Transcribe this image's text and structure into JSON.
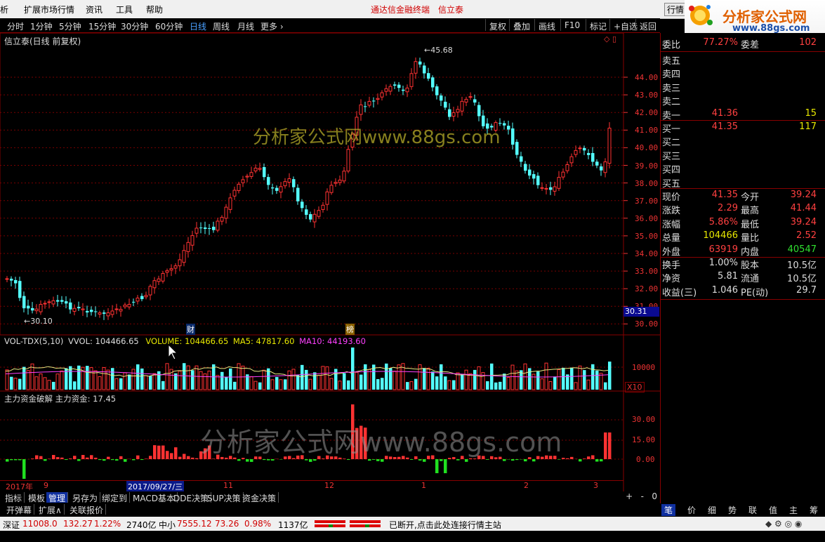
{
  "menu": {
    "items": [
      "析",
      "扩展市场行情",
      "资讯",
      "工具",
      "帮助"
    ],
    "title_left": "通达信金融终端",
    "title_right": "信立泰",
    "right_btn": "行情"
  },
  "logo": {
    "text": "分析家公式网",
    "url": "www.88gs.com"
  },
  "timeframes": [
    "分时",
    "1分钟",
    "5分钟",
    "15分钟",
    "30分钟",
    "60分钟",
    "日线",
    "周线",
    "月线",
    "更多 ›"
  ],
  "active_timeframe": "日线",
  "tool_buttons": [
    "复权",
    "叠加",
    "画线",
    "F10",
    "标记",
    "+自选",
    "返回"
  ],
  "chart_title": "信立泰(日线 前复权)",
  "watermark_main": "分析家公式网www.88gs.com",
  "watermark_bottom": "分析家公式网www.88gs.com",
  "price_axis": [
    "44.00",
    "43.00",
    "42.00",
    "41.00",
    "40.00",
    "39.00",
    "38.00",
    "37.00",
    "36.00",
    "35.00",
    "34.00",
    "33.00",
    "32.00",
    "31.00",
    "30.00"
  ],
  "current_price_tag": "30.31",
  "high_label": "45.68",
  "low_label": "30.10",
  "event_markers": [
    "财",
    "榜"
  ],
  "vol_header": {
    "name": "VOL-TDX(5,10)",
    "vvol": "VVOL: 104466.65",
    "volume": "VOLUME: 104466.65",
    "ma5": "MA5: 47817.60",
    "ma10": "MA10: 44193.60"
  },
  "vol_axis": [
    "10000"
  ],
  "vol_unit": "X10",
  "fund_header": "主力资金破解  主力资金: 17.45",
  "fund_axis": [
    "30.00",
    "15.00",
    "0.00"
  ],
  "date_axis": [
    "2017年",
    "9",
    "2017/09/27/三",
    "11",
    "12",
    "1",
    "2",
    "3"
  ],
  "bottom_tabs": [
    "指标",
    "模板",
    "管理",
    "另存为",
    "绑定到",
    "MACD基本",
    "DDE决策",
    "SUP决策",
    "资金决策"
  ],
  "bottom_tabs2": [
    "开弹幕",
    "扩展∧",
    "关联报价"
  ],
  "right_panel": {
    "weibi": {
      "label": "委比",
      "value": "77.27%",
      "label2": "委差",
      "value2": "102"
    },
    "sell": [
      {
        "label": "卖五",
        "price": "",
        "vol": ""
      },
      {
        "label": "卖四",
        "price": "",
        "vol": ""
      },
      {
        "label": "卖三",
        "price": "",
        "vol": ""
      },
      {
        "label": "卖二",
        "price": "",
        "vol": ""
      },
      {
        "label": "卖一",
        "price": "41.36",
        "vol": "15"
      }
    ],
    "buy": [
      {
        "label": "买一",
        "price": "41.35",
        "vol": "117"
      },
      {
        "label": "买二",
        "price": "",
        "vol": ""
      },
      {
        "label": "买三",
        "price": "",
        "vol": ""
      },
      {
        "label": "买四",
        "price": "",
        "vol": ""
      },
      {
        "label": "买五",
        "price": "",
        "vol": ""
      }
    ],
    "stats": [
      {
        "l1": "现价",
        "v1": "41.35",
        "c1": "red",
        "l2": "今开",
        "v2": "39.24",
        "c2": "red"
      },
      {
        "l1": "涨跌",
        "v1": "2.29",
        "c1": "red",
        "l2": "最高",
        "v2": "41.44",
        "c2": "red"
      },
      {
        "l1": "涨幅",
        "v1": "5.86%",
        "c1": "red",
        "l2": "最低",
        "v2": "39.24",
        "c2": "red"
      },
      {
        "l1": "总量",
        "v1": "104466",
        "c1": "yel",
        "l2": "量比",
        "v2": "2.52",
        "c2": "red"
      },
      {
        "l1": "外盘",
        "v1": "63919",
        "c1": "red",
        "l2": "内盘",
        "v2": "40547",
        "c2": "green"
      },
      {
        "l1": "换手",
        "v1": "1.00%",
        "c1": "wht",
        "l2": "股本",
        "v2": "10.5亿",
        "c2": "wht"
      },
      {
        "l1": "净资",
        "v1": "5.81",
        "c1": "wht",
        "l2": "流通",
        "v2": "10.5亿",
        "c2": "wht"
      },
      {
        "l1": "收益(三)",
        "v1": "1.046",
        "c1": "wht",
        "l2": "PE(动)",
        "v2": "29.7",
        "c2": "wht"
      }
    ]
  },
  "right_tabs": [
    "笔",
    "价",
    "细",
    "势",
    "联",
    "值",
    "主",
    "筹"
  ],
  "status": {
    "sz_label": "深证",
    "sz_value": "11008.0",
    "sz_chg": "132.27",
    "sz_pct": "1.22%",
    "sz_amt": "2740亿",
    "zx_label": "中小",
    "zx_value": "7555.12",
    "zx_chg": "73.26",
    "zx_pct": "0.98%",
    "zx_amt": "1137亿",
    "msg": "已断开,点击此处连接行情主站"
  },
  "colors": {
    "up": "#ff3232",
    "down": "#54ffff",
    "bg": "#000000",
    "grid": "#7a0000",
    "ma5": "#e8e880",
    "ma10": "#ff40ff"
  }
}
